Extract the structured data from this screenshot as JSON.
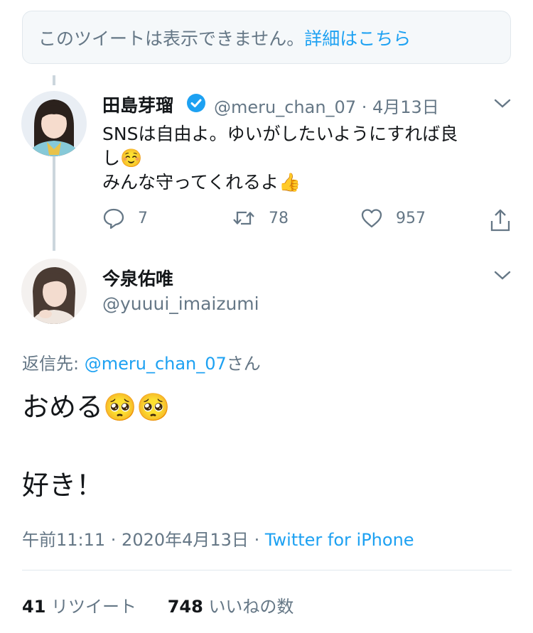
{
  "notice": {
    "text": "このツイートは表示できません。",
    "link": "詳細はこちら"
  },
  "quoted": {
    "name": "田島芽瑠",
    "handle": "@meru_chan_07",
    "date": "· 4月13日",
    "line1": "SNSは自由よ。ゆいがしたいようにすれば良",
    "line2": "し",
    "line3": "みんな守ってくれるよ",
    "emoji_blush": "☺️",
    "emoji_thumb": "👍",
    "reply_count": "7",
    "retweet_count": "78",
    "like_count": "957"
  },
  "main": {
    "name": "今泉佑唯",
    "handle": "@yuuui_imaizumi",
    "reply_prefix": "返信先: ",
    "reply_handle": "@meru_chan_07",
    "reply_suffix": "さん",
    "text1": "おめる",
    "emoji_eyes": "🥺",
    "text2": "好き！",
    "time": "午前11:11 · 2020年4月13日 ·",
    "source": "Twitter for iPhone",
    "retweets_num": "41",
    "retweets_label": "リツイート",
    "likes_num": "748",
    "likes_label": "いいねの数"
  },
  "colors": {
    "accent": "#1da1f2",
    "secondary": "#657786",
    "line": "#ccd6dd",
    "verified": "#1da1f2"
  },
  "icons": [
    "verified-badge-icon",
    "chevron-down-icon",
    "reply-icon",
    "retweet-icon",
    "like-icon",
    "share-icon"
  ]
}
